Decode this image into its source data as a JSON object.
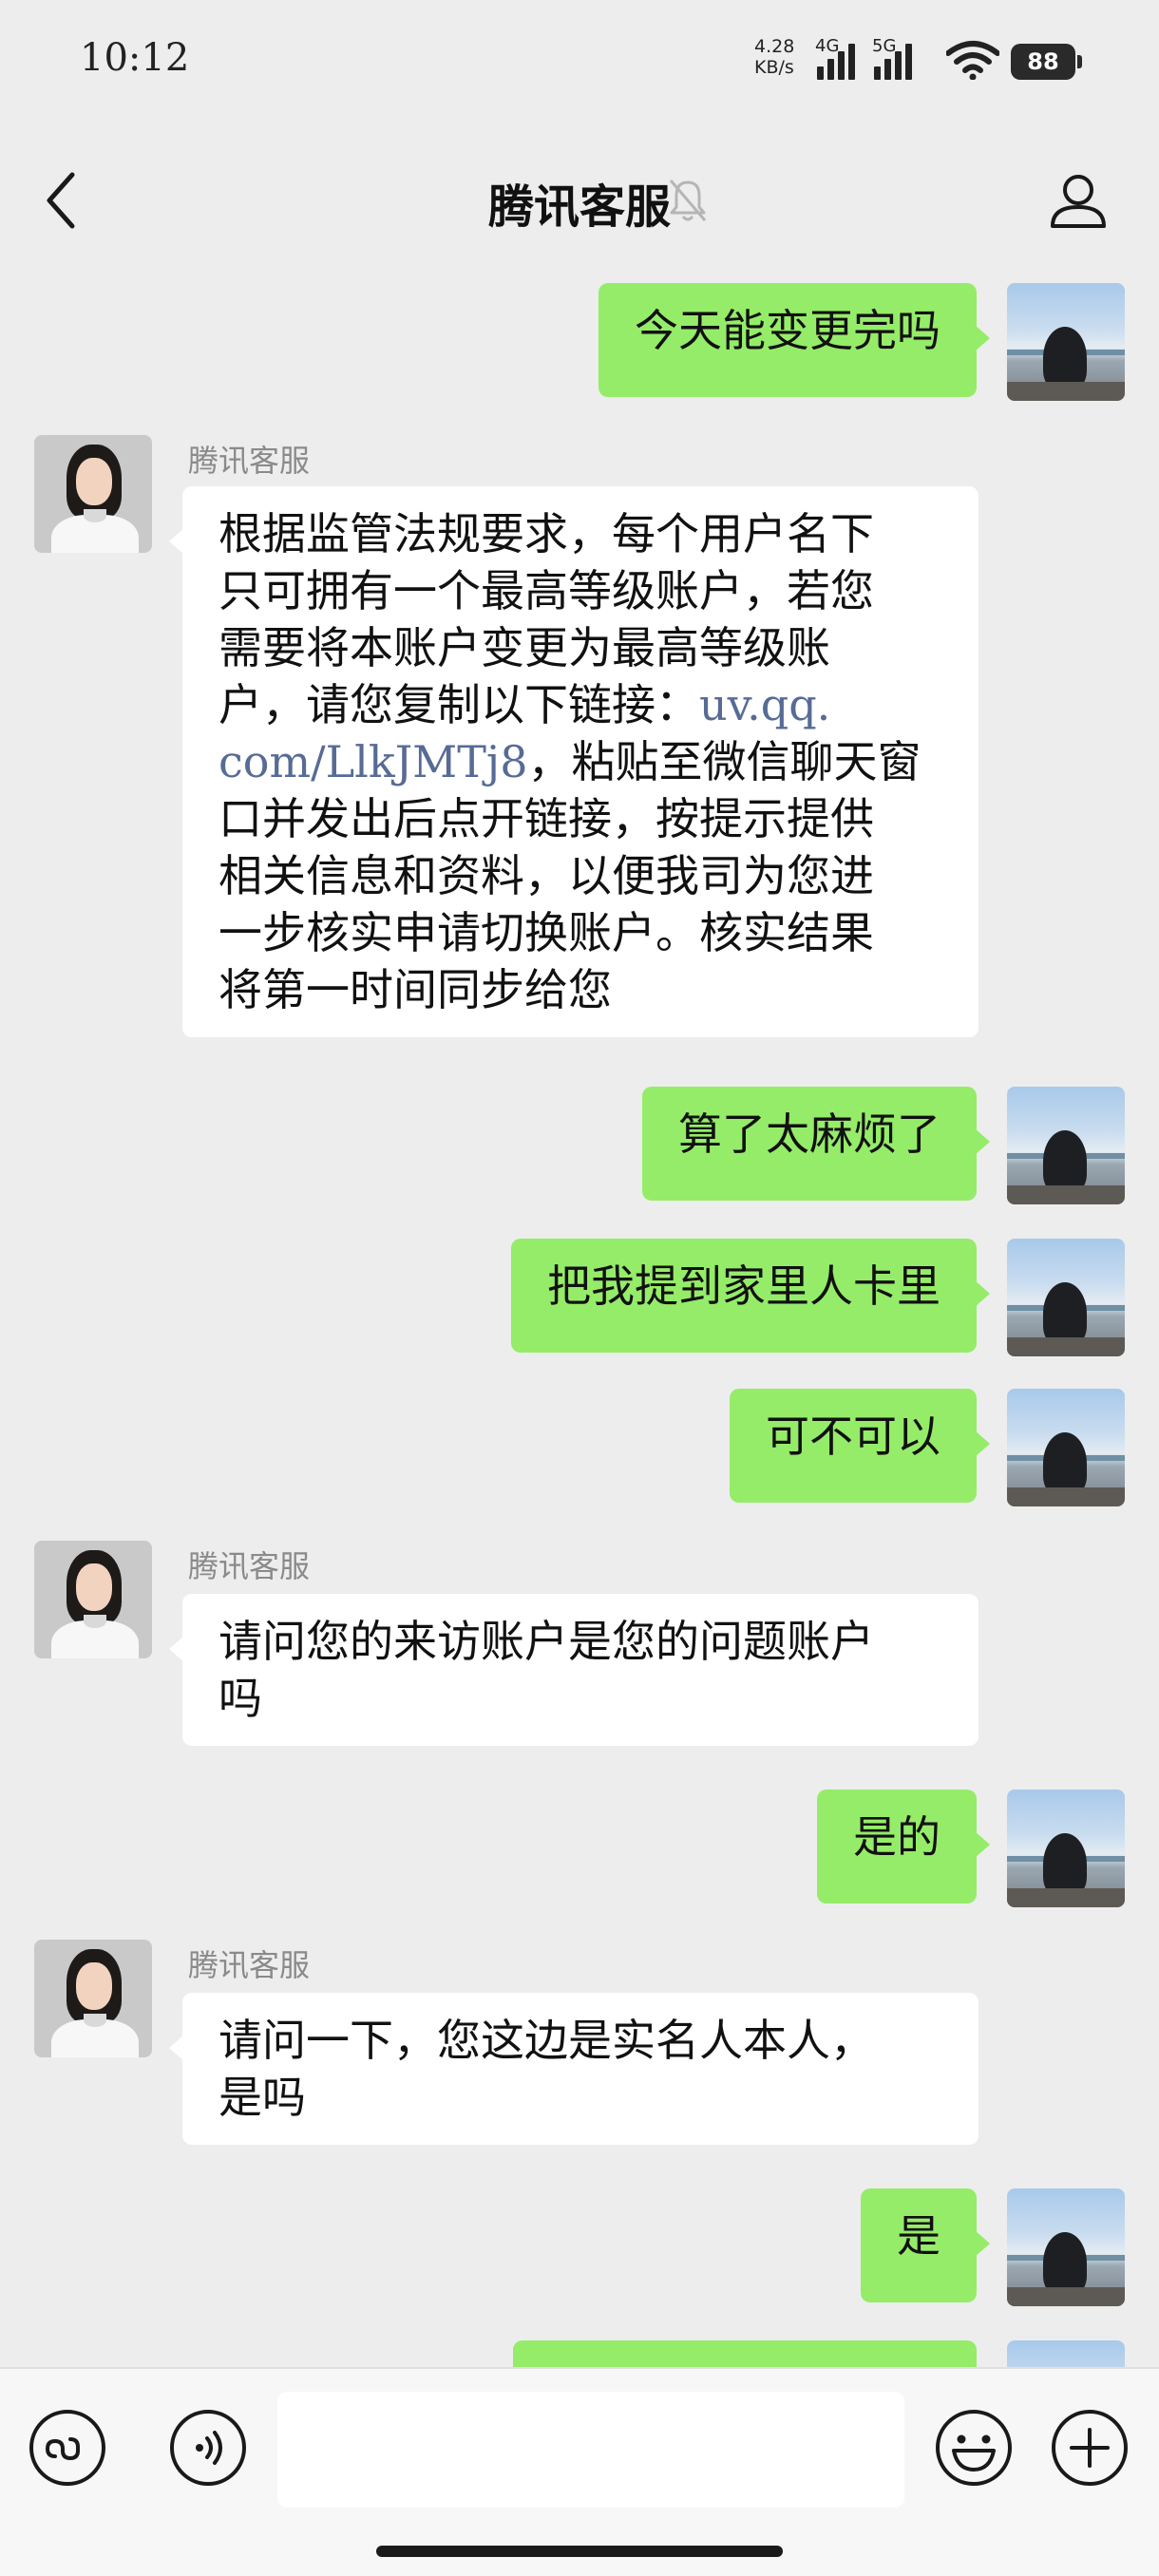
{
  "status_bar": {
    "time": "10:12",
    "net_speed_value": "4.28",
    "net_speed_unit": "KB/s",
    "sim1_gen": "4G",
    "sim2_gen": "5G",
    "battery": "88"
  },
  "header": {
    "title": "腾讯客服",
    "back_icon": "chevron-left-icon",
    "mute_icon": "bell-muted-icon",
    "profile_icon": "person-icon"
  },
  "messages": [
    {
      "from": "me",
      "text": "今天能变更完吗"
    },
    {
      "from": "agent",
      "sender": "腾讯客服",
      "line1": "根据监管法规要求，每个用户名下",
      "line2": "只可拥有一个最高等级账户，若您",
      "line3": "需要将本账户变更为最高等级账",
      "line4_pre": "户，请您复制以下链接：",
      "link_a": "uv.qq.",
      "link_b": "com/LlkJMTj8",
      "line5_post": "，粘贴至微信聊天窗",
      "line6": "口并发出后点开链接，按提示提供",
      "line7": "相关信息和资料，以便我司为您进",
      "line8": "一步核实申请切换账户。核实结果",
      "line9": "将第一时间同步给您"
    },
    {
      "from": "me",
      "text": "算了太麻烦了"
    },
    {
      "from": "me",
      "text": "把我提到家里人卡里"
    },
    {
      "from": "me",
      "text": "可不可以"
    },
    {
      "from": "agent",
      "sender": "腾讯客服",
      "line1": "请问您的来访账户是您的问题账户",
      "line2": "吗"
    },
    {
      "from": "me",
      "text": "是的"
    },
    {
      "from": "agent",
      "sender": "腾讯客服",
      "line1": "请问一下，您这边是实名人本人，",
      "line2": "是吗"
    },
    {
      "from": "me",
      "text": "是"
    }
  ],
  "toolbar": {
    "mini_program_icon": "mini-program-icon",
    "voice_icon": "voice-icon",
    "input_value": "",
    "emoji_icon": "emoji-icon",
    "plus_icon": "plus-icon"
  },
  "colors": {
    "background": "#ededed",
    "my_bubble": "#95ec69",
    "agent_bubble": "#ffffff",
    "link": "#576b95"
  }
}
